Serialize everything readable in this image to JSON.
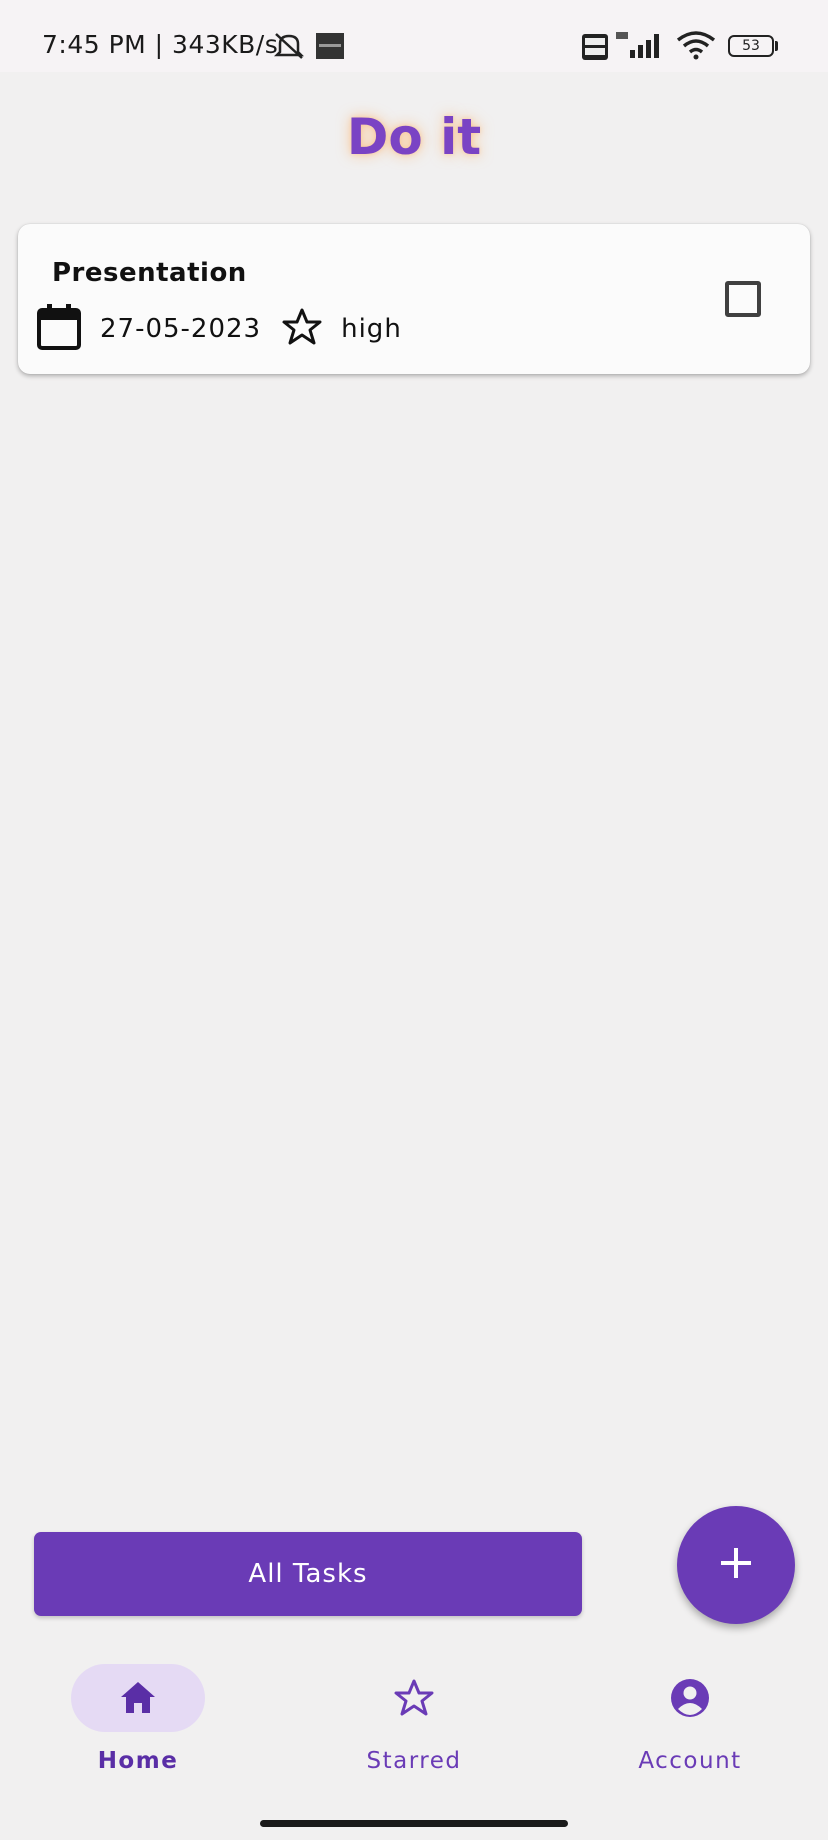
{
  "status_bar": {
    "time_text": "7:45 PM | 343KB/s",
    "battery": "53",
    "icons": [
      "mute-bell-icon",
      "app-notification-icon",
      "volte-icon",
      "signal-4g-icon",
      "wifi-icon",
      "battery-icon"
    ]
  },
  "app": {
    "title": "Do it"
  },
  "tasks": [
    {
      "title": "Presentation",
      "date": "27-05-2023",
      "priority": "high",
      "completed": false
    }
  ],
  "actions": {
    "all_tasks_label": "All Tasks",
    "add_icon": "plus-icon"
  },
  "bottom_nav": {
    "items": [
      {
        "label": "Home",
        "icon": "home-icon",
        "active": true
      },
      {
        "label": "Starred",
        "icon": "star-icon",
        "active": false
      },
      {
        "label": "Account",
        "icon": "account-circle-icon",
        "active": false
      }
    ]
  },
  "colors": {
    "accent": "#6a3bb6",
    "title_purple": "#7a43c4",
    "active_pill": "#e5daf4",
    "background": "#f1f0f0"
  }
}
